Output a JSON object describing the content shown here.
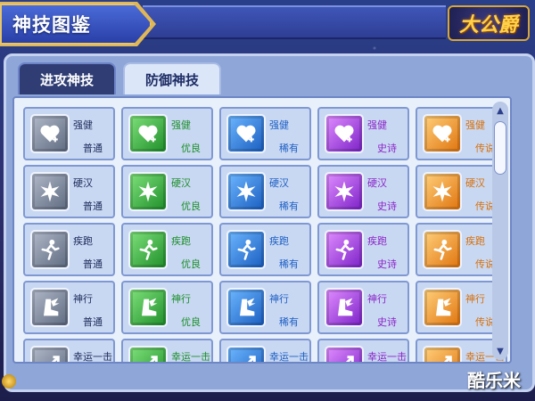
{
  "title": "神技图鉴",
  "logo_text": "大公爵",
  "tabs": [
    {
      "label": "进攻神技",
      "active": true
    },
    {
      "label": "防御神技",
      "active": false
    }
  ],
  "qualities": [
    "普通",
    "优良",
    "稀有",
    "史诗",
    "传说"
  ],
  "quality_colors": {
    "common": "#1b2a5a",
    "good": "#1d8f2c",
    "rare": "#1d5fc4",
    "epic": "#8a25c8",
    "legend": "#d6700a"
  },
  "rows": [
    {
      "name": "强健",
      "icon": "heart-plus-icon"
    },
    {
      "name": "硬汉",
      "icon": "burst-icon"
    },
    {
      "name": "疾跑",
      "icon": "running-figure-icon"
    },
    {
      "name": "神行",
      "icon": "winged-boot-icon"
    },
    {
      "name": "幸运一击",
      "icon": "lucky-strike-icon"
    }
  ],
  "watermark": "酷乐米"
}
